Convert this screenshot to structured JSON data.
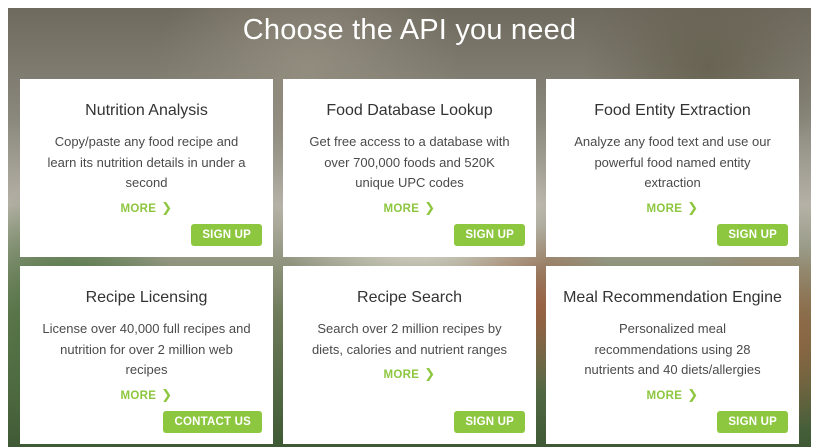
{
  "hero": {
    "title": "Choose the API you need"
  },
  "cards": [
    {
      "title": "Nutrition Analysis",
      "description": "Copy/paste any food recipe and learn its nutrition details in under a second",
      "more_label": "MORE",
      "action_label": "SIGN UP"
    },
    {
      "title": "Food Database Lookup",
      "description": "Get free access to a database with over 700,000 foods and 520K unique UPC codes",
      "more_label": "MORE",
      "action_label": "SIGN UP"
    },
    {
      "title": "Food Entity Extraction",
      "description": "Analyze any food text and use our powerful food named entity extraction",
      "more_label": "MORE",
      "action_label": "SIGN UP"
    },
    {
      "title": "Recipe Licensing",
      "description": "License over 40,000 full recipes and nutrition for over 2 million web recipes",
      "more_label": "MORE",
      "action_label": "CONTACT US"
    },
    {
      "title": "Recipe Search",
      "description": "Search over 2 million recipes by diets, calories and nutrient ranges",
      "more_label": "MORE",
      "action_label": "SIGN UP"
    },
    {
      "title": "Meal Recommendation Engine",
      "description": "Personalized meal recommendations using 28 nutrients and 40 diets/allergies",
      "more_label": "MORE",
      "action_label": "SIGN UP"
    }
  ],
  "icons": {
    "more_chevron": "chevron-right-icon"
  },
  "colors": {
    "accent": "#8dc63f",
    "card_background": "#ffffff",
    "title_text": "#333333"
  }
}
